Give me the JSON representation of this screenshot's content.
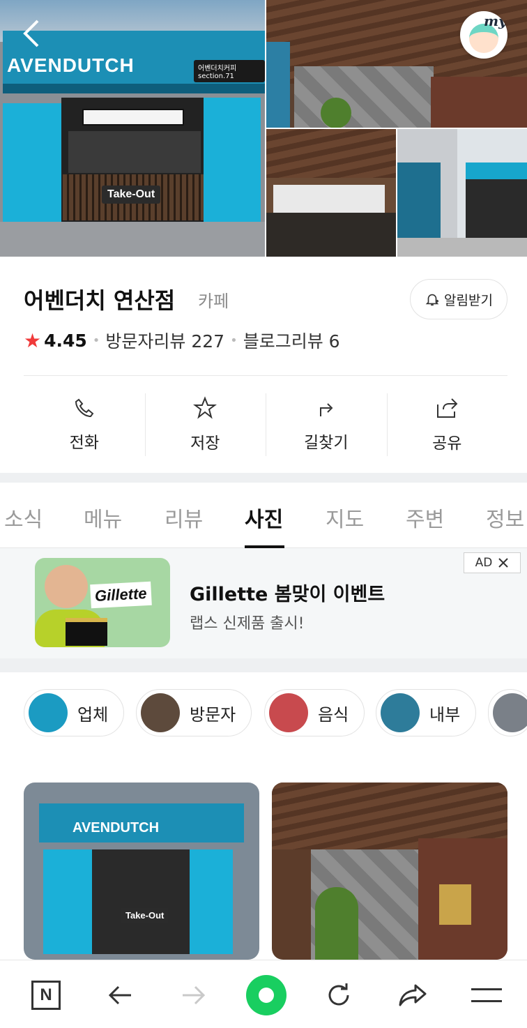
{
  "place": {
    "name": "어벤더치 연산점",
    "category": "카페",
    "rating": "4.45",
    "visitor_reviews": "방문자리뷰 227",
    "blog_reviews": "블로그리뷰 6",
    "alarm_label": "알림받기"
  },
  "hero": {
    "sign_text": "AVENDUTCH",
    "sign_sub": "어벤더치커피 section.71",
    "takeout": "Take-Out",
    "my_label": "my"
  },
  "actions": [
    {
      "label": "전화",
      "icon": "phone-icon"
    },
    {
      "label": "저장",
      "icon": "star-icon"
    },
    {
      "label": "길찾기",
      "icon": "directions-icon"
    },
    {
      "label": "공유",
      "icon": "share-icon"
    }
  ],
  "tabs": [
    "소식",
    "메뉴",
    "리뷰",
    "사진",
    "지도",
    "주변",
    "정보"
  ],
  "active_tab": "사진",
  "ad": {
    "title": "Gillette 봄맞이 이벤트",
    "subtitle": "랩스 신제품 출시!",
    "logo_text": "Gillette",
    "badge": "AD"
  },
  "chips": [
    "업체",
    "방문자",
    "음식",
    "내부"
  ],
  "colors": {
    "accent_green": "#19ce60",
    "rating_star": "#f03a3a",
    "store_teal": "#1bb0d8"
  },
  "bottom_bar": [
    "naver-home-icon",
    "back-arrow-icon",
    "forward-arrow-icon",
    "green-dot-icon",
    "refresh-icon",
    "share-arrow-icon",
    "menu-icon"
  ]
}
